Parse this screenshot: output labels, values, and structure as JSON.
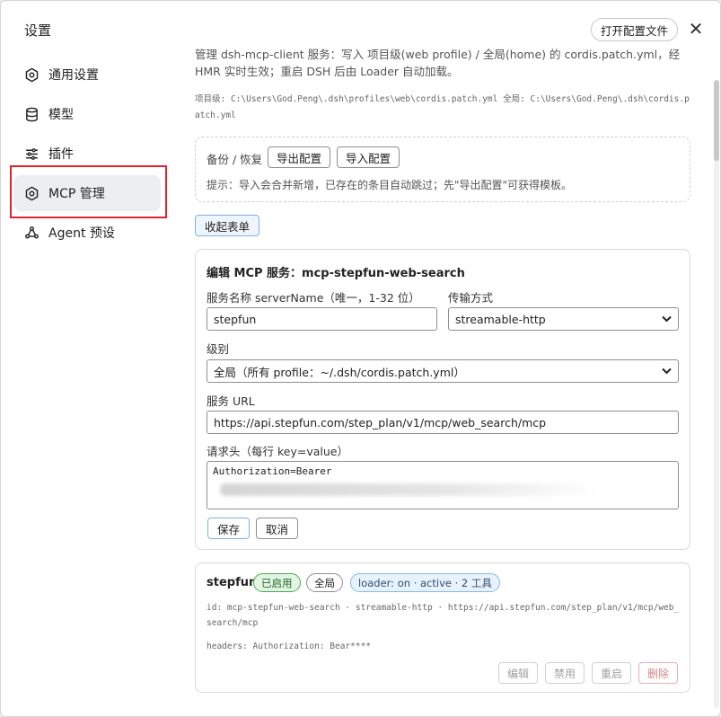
{
  "sidebar": {
    "title": "设置",
    "items": [
      {
        "label": "通用设置",
        "icon": "gear-icon"
      },
      {
        "label": "模型",
        "icon": "database-icon"
      },
      {
        "label": "插件",
        "icon": "sliders-icon"
      },
      {
        "label": "MCP 管理",
        "icon": "gear-icon",
        "active": true
      },
      {
        "label": "Agent 预设",
        "icon": "nodes-icon"
      }
    ]
  },
  "header": {
    "open_config_label": "打开配置文件",
    "close_symbol": "✕"
  },
  "description": "管理 dsh-mcp-client 服务：写入 项目级(web profile) / 全局(home) 的 cordis.patch.yml，经 HMR 实时生效；重启 DSH 后由 Loader 自动加载。",
  "paths": "项目级: C:\\Users\\God.Peng\\.dsh\\profiles\\web\\cordis.patch.yml 全局: C:\\Users\\God.Peng\\.dsh\\cordis.patch.yml",
  "backup": {
    "label": "备份 / 恢复",
    "export_label": "导出配置",
    "import_label": "导入配置",
    "hint": "提示：导入会合并新增，已存在的条目自动跳过；先\"导出配置\"可获得模板。"
  },
  "collapse_label": "收起表单",
  "form": {
    "title": "编辑 MCP 服务：mcp-stepfun-web-search",
    "server_name_label": "服务名称 serverName（唯一，1-32 位）",
    "server_name_value": "stepfun",
    "transport_label": "传输方式",
    "transport_value": "streamable-http",
    "scope_label": "级别",
    "scope_value": "全局（所有 profile：~/.dsh/cordis.patch.yml）",
    "url_label": "服务 URL",
    "url_value": "https://api.stepfun.com/step_plan/v1/mcp/web_search/mcp",
    "headers_label": "请求头（每行 key=value）",
    "headers_value": "Authorization=Bearer",
    "save_label": "保存",
    "cancel_label": "取消"
  },
  "server": {
    "name": "stepfun",
    "status_badge": "已启用",
    "scope_badge": "全局",
    "loader_badge": "loader: on · active · 2 工具",
    "meta_line": "id: mcp-stepfun-web-search · streamable-http · https://api.stepfun.com/step_plan/v1/mcp/web_search/mcp",
    "headers_line": "headers: Authorization: Bear****",
    "actions": {
      "edit": "编辑",
      "disable": "禁用",
      "restart": "重启",
      "delete": "删除"
    }
  },
  "colors": {
    "highlight": "#e0242f",
    "active_bg": "#eceef1",
    "enabled_green": "#4aa957",
    "accent_blue": "#7fb2e6"
  }
}
